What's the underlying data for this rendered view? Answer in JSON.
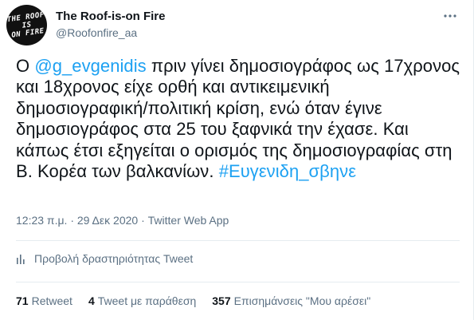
{
  "author": {
    "display_name": "The Roof-is-on Fire",
    "handle": "@Roofonfire_aa",
    "avatar_text": "THE ROOF\nIS\nON FIRE"
  },
  "tweet": {
    "text_before": "Ο ",
    "mention": "@g_evgenidis",
    "text_middle": " πριν γίνει δημοσιογράφος ως 17χρονος και 18χρονος είχε ορθή και αντικειμενική δημοσιογραφική/πολιτική κρίση, ενώ όταν έγινε δημοσιογράφος στα 25 του ξαφνικά την έχασε. Και κάπως έτσι εξηγείται ο ορισμός της δημοσιογραφίας στη Β. Κορέα των βαλκανίων. ",
    "hashtag": "#Ευγενιδη_σβηνε",
    "timestamp": "12:23 π.μ. · 29 Δεκ 2020 · Twitter Web App"
  },
  "activity": {
    "label": "Προβολή δραστηριότητας Tweet"
  },
  "stats": {
    "retweets_count": "71",
    "retweets_label": "Retweet",
    "quotes_count": "4",
    "quotes_label": "Tweet με παράθεση",
    "likes_count": "357",
    "likes_label": "Επισημάνσεις \"Μου αρέσει\""
  },
  "colors": {
    "link": "#1da1f2",
    "secondary_text": "#5b7083",
    "divider": "#e6ecf0"
  },
  "icons": [
    "more-options-icon",
    "activity-bar-chart-icon"
  ]
}
